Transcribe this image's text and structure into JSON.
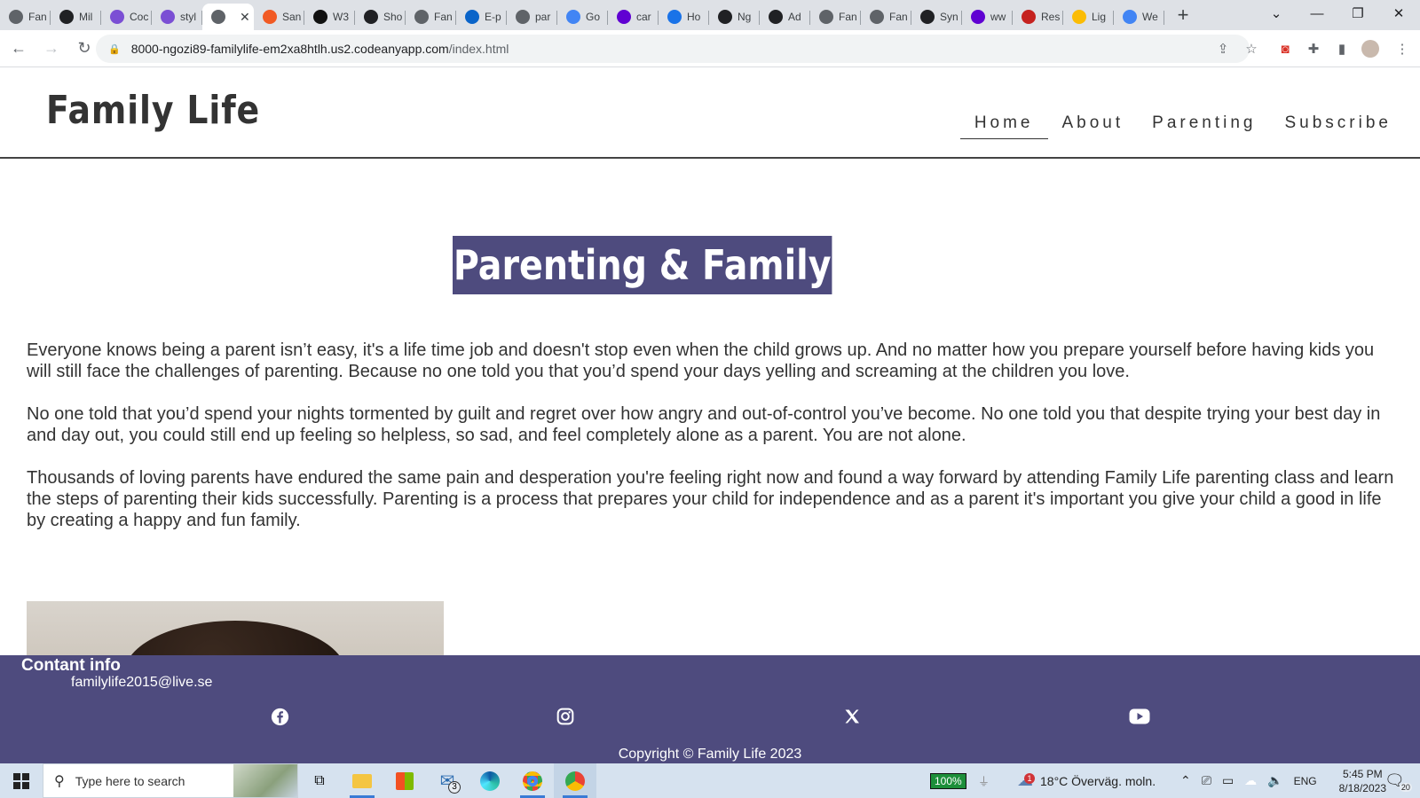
{
  "browser": {
    "tabs": [
      {
        "label": "Fan",
        "icon": "globe-icon",
        "color": "#5f6368"
      },
      {
        "label": "Mil",
        "icon": "github-icon",
        "color": "#202124"
      },
      {
        "label": "Coc",
        "icon": "cube-icon",
        "color": "#7b4fd4"
      },
      {
        "label": "styl",
        "icon": "cube-icon",
        "color": "#7b4fd4"
      },
      {
        "label": "",
        "icon": "globe-icon",
        "color": "#5f6368",
        "active": true
      },
      {
        "label": "San",
        "icon": "circle-icon",
        "color": "#f15a24"
      },
      {
        "label": "W3",
        "icon": "w3-icon",
        "color": "#111111"
      },
      {
        "label": "Sho",
        "icon": "shop-icon",
        "color": "#202124"
      },
      {
        "label": "Fan",
        "icon": "globe-icon",
        "color": "#5f6368"
      },
      {
        "label": "E-p",
        "icon": "outlook-icon",
        "color": "#0a64c9"
      },
      {
        "label": "par",
        "icon": "globe-icon",
        "color": "#5f6368"
      },
      {
        "label": "Go",
        "icon": "translate-icon",
        "color": "#4285f4"
      },
      {
        "label": "car",
        "icon": "yahoo-icon",
        "color": "#6001d2"
      },
      {
        "label": "Ho",
        "icon": "c-icon",
        "color": "#1a73e8"
      },
      {
        "label": "Ng",
        "icon": "github-icon",
        "color": "#202124"
      },
      {
        "label": "Ad",
        "icon": "github-icon",
        "color": "#202124"
      },
      {
        "label": "Fan",
        "icon": "globe-icon",
        "color": "#5f6368"
      },
      {
        "label": "Fan",
        "icon": "globe-icon",
        "color": "#5f6368"
      },
      {
        "label": "Syn",
        "icon": "smile-icon",
        "color": "#202124"
      },
      {
        "label": "ww",
        "icon": "yahoo-icon",
        "color": "#6001d2"
      },
      {
        "label": "Res",
        "icon": "red-icon",
        "color": "#c5221f"
      },
      {
        "label": "Lig",
        "icon": "drive-icon",
        "color": "#fbbc04"
      },
      {
        "label": "We",
        "icon": "google-icon",
        "color": "#4285f4"
      }
    ],
    "url_host": "8000-ngozi89-familylife-em2xa8htlh.us2.codeanyapp.com",
    "url_path": "/index.html"
  },
  "site": {
    "logo": "Family Life",
    "nav": [
      {
        "label": "Home",
        "active": true
      },
      {
        "label": "About",
        "active": false
      },
      {
        "label": "Parenting",
        "active": false
      },
      {
        "label": "Subscribe",
        "active": false
      }
    ],
    "hero_title": "Parenting & Family",
    "paragraphs": [
      "Everyone knows being a parent isn’t easy, it's a life time job and doesn't stop even when the child grows up. And no matter how you prepare yourself before having kids you will still face the challenges of parenting. Because no one told you that you’d spend your days yelling and screaming at the children you love.",
      "No one told that you’d spend your nights tormented by guilt and regret over how angry and out-of-control you’ve become. No one told you that despite trying your best day in and day out, you could still end up feeling so helpless, so sad, and feel completely alone as a parent. You are not alone.",
      "Thousands of loving parents have endured the same pain and desperation you're feeling right now and found a way forward by attending Family Life parenting class and learn the steps of parenting their kids successfully. Parenting is a process that prepares your child for independence and as a parent it's important you give your child a good in life by creating a happy and fun family."
    ],
    "footer": {
      "title": "Contant info",
      "email": "familylife2015@live.se",
      "social": [
        "facebook-icon",
        "instagram-icon",
        "x-icon",
        "youtube-icon"
      ],
      "copyright": "Copyright © Family Life 2023"
    },
    "accent_color": "#4e4b7e"
  },
  "taskbar": {
    "search_placeholder": "Type here to search",
    "mail_badge": "3",
    "battery": "100%",
    "weather": "18°C  Överväg. moln.",
    "weather_alert": "1",
    "language": "ENG",
    "time": "5:45 PM",
    "date": "8/18/2023",
    "notifications": "20"
  }
}
